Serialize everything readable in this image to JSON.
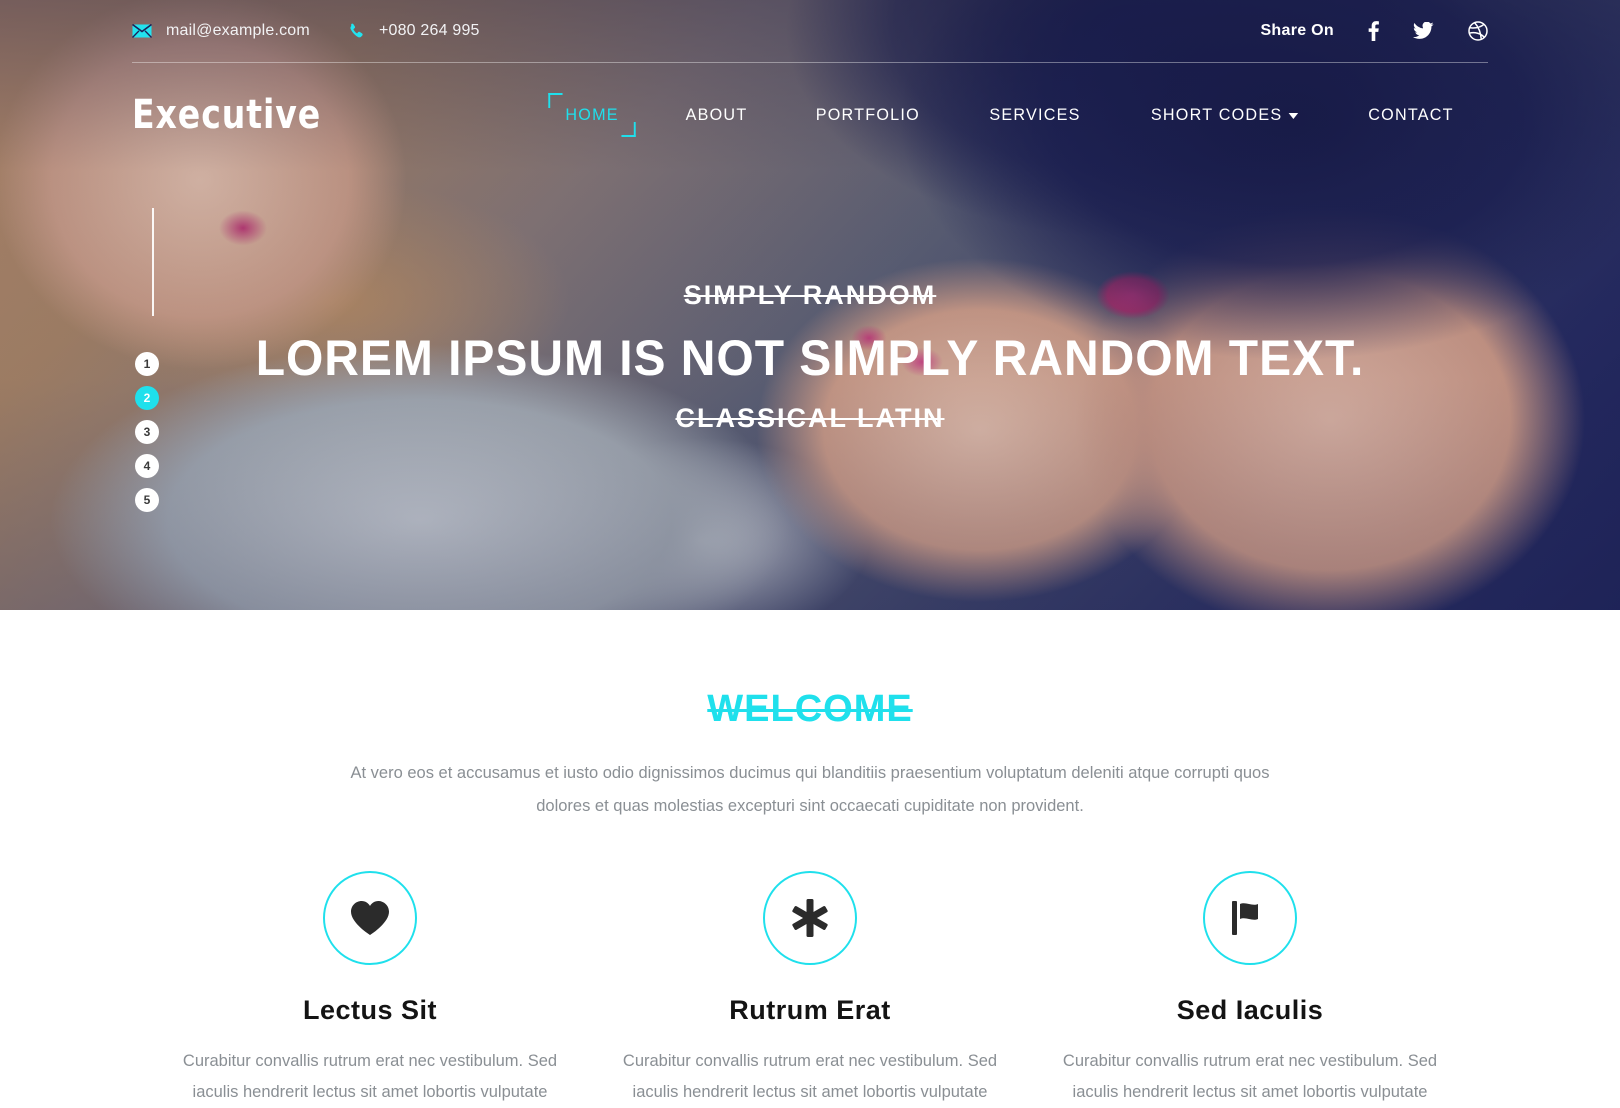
{
  "topbar": {
    "email": "mail@example.com",
    "phone": "+080 264 995",
    "email_icon": "mail-icon",
    "phone_icon": "phone-icon",
    "share_label": "Share On",
    "socials": [
      {
        "name": "facebook-icon",
        "glyph": "f"
      },
      {
        "name": "twitter-icon",
        "glyph": "t"
      },
      {
        "name": "dribbble-icon",
        "glyph": "d"
      }
    ]
  },
  "nav": {
    "logo": "Executive",
    "items": [
      {
        "label": "HOME",
        "active": true,
        "caret": false
      },
      {
        "label": "ABOUT",
        "active": false,
        "caret": false
      },
      {
        "label": "PORTFOLIO",
        "active": false,
        "caret": false
      },
      {
        "label": "SERVICES",
        "active": false,
        "caret": false
      },
      {
        "label": "SHORT CODES",
        "active": false,
        "caret": true
      },
      {
        "label": "CONTACT",
        "active": false,
        "caret": false
      }
    ]
  },
  "hero": {
    "subtitle_top": "SIMPLY RANDOM",
    "title": "LOREM IPSUM IS NOT SIMPLY RANDOM TEXT.",
    "subtitle_bottom": "CLASSICAL LATIN",
    "pager": [
      "1",
      "2",
      "3",
      "4",
      "5"
    ],
    "active_slide": "2"
  },
  "welcome": {
    "title": "WELCOME",
    "text": "At vero eos et accusamus et iusto odio dignissimos ducimus qui blanditiis praesentium voluptatum deleniti atque corrupti quos dolores et quas molestias excepturi sint occaecati cupiditate non provident."
  },
  "features": [
    {
      "icon": "heart-icon",
      "title": "Lectus Sit",
      "text": "Curabitur convallis rutrum erat nec vestibulum. Sed iaculis hendrerit lectus sit amet lobortis vulputate"
    },
    {
      "icon": "asterisk-icon",
      "title": "Rutrum Erat",
      "text": "Curabitur convallis rutrum erat nec vestibulum. Sed iaculis hendrerit lectus sit amet lobortis vulputate"
    },
    {
      "icon": "flag-icon",
      "title": "Sed Iaculis",
      "text": "Curabitur convallis rutrum erat nec vestibulum. Sed iaculis hendrerit lectus sit amet lobortis vulputate"
    }
  ],
  "colors": {
    "accent": "#1fe0ec",
    "nav_dark": "#1b2058",
    "body_text": "#8a8f94"
  }
}
